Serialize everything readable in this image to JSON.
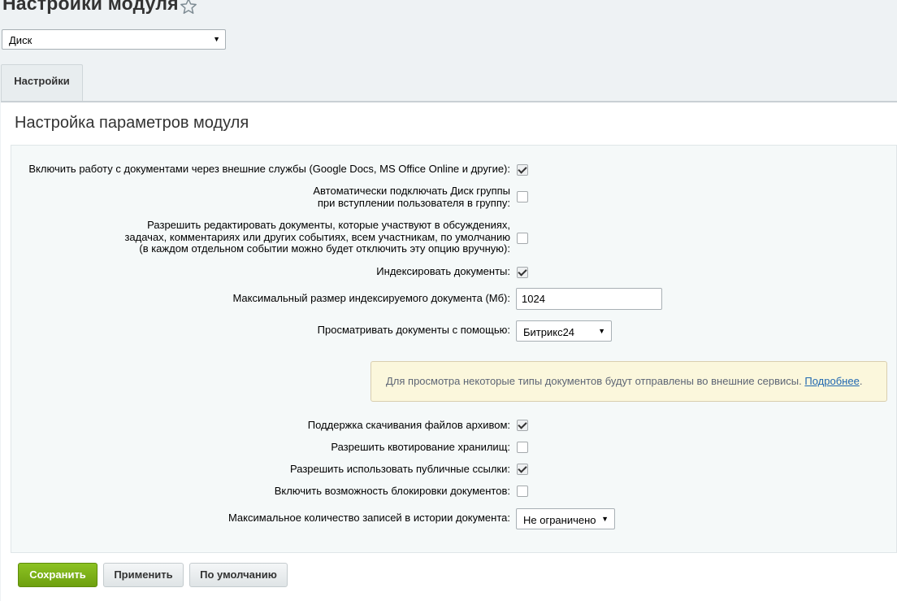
{
  "header": {
    "title": "Настройки модуля",
    "favorite_icon": "star-icon"
  },
  "module_select": {
    "value": "Диск"
  },
  "tabs": [
    {
      "label": "Настройки"
    }
  ],
  "section": {
    "title": "Настройка параметров модуля"
  },
  "settings": {
    "external_docs": {
      "label": "Включить работу с документами через внешние службы (Google Docs, MS Office Online и другие):",
      "checked": true
    },
    "auto_connect_disk": {
      "label_line1": "Автоматически подключать Диск группы",
      "label_line2": "при вступлении пользователя в группу:",
      "checked": false
    },
    "allow_edit": {
      "label_line1": "Разрешить редактировать документы, которые участвуют в обсуждениях,",
      "label_line2": "задачах, комментариях или других событиях, всем участникам, по умолчанию",
      "label_line3": "(в каждом отдельном событии можно будет отключить эту опцию вручную):",
      "checked": false
    },
    "index_docs": {
      "label": "Индексировать документы:",
      "checked": true
    },
    "max_index_size": {
      "label": "Максимальный размер индексируемого документа (Мб):",
      "value": "1024"
    },
    "viewer": {
      "label": "Просматривать документы с помощью:",
      "value": "Битрикс24"
    },
    "notice": {
      "text": "Для просмотра некоторые типы документов будут отправлены во внешние сервисы.",
      "link": "Подробнее",
      "suffix": "."
    },
    "archive_download": {
      "label": "Поддержка скачивания файлов архивом:",
      "checked": true
    },
    "storage_quota": {
      "label": "Разрешить квотирование хранилищ:",
      "checked": false
    },
    "public_links": {
      "label": "Разрешить использовать публичные ссылки:",
      "checked": true
    },
    "doc_lock": {
      "label": "Включить возможность блокировки документов:",
      "checked": false
    },
    "history_limit": {
      "label": "Максимальное количество записей в истории документа:",
      "value": "Не ограничено"
    }
  },
  "buttons": {
    "save": "Сохранить",
    "apply": "Применить",
    "default": "По умолчанию"
  }
}
